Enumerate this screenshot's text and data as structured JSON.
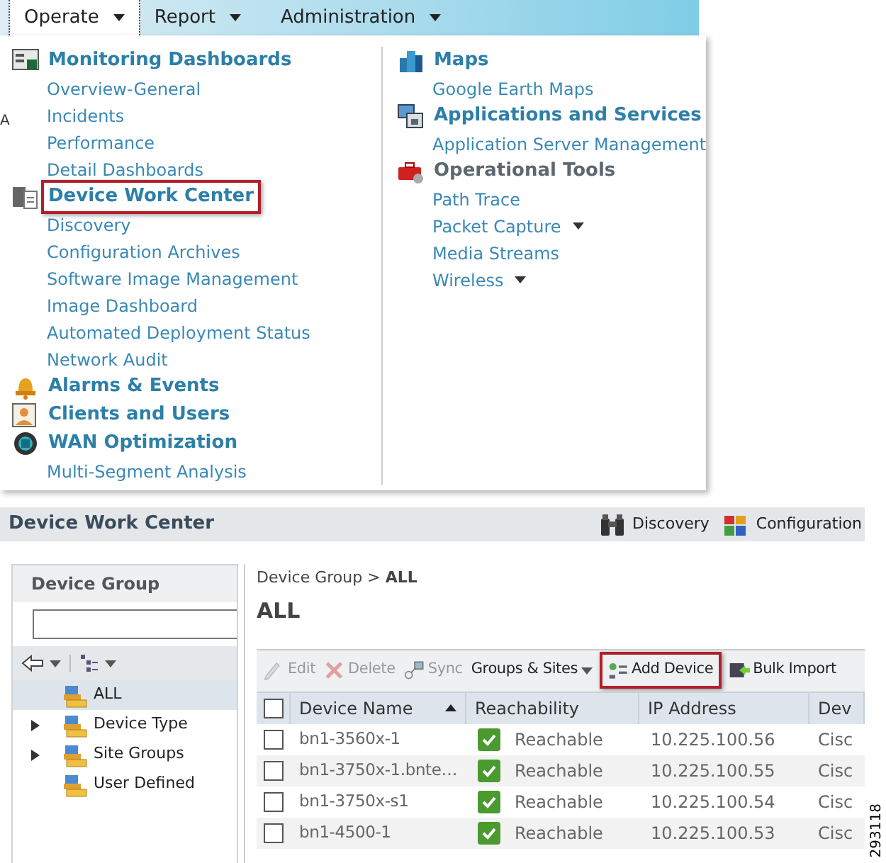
{
  "background_fragment": "A",
  "nav": {
    "tabs": [
      {
        "label": "Operate",
        "selected": true
      },
      {
        "label": "Report",
        "selected": false
      },
      {
        "label": "Administration",
        "selected": false
      }
    ]
  },
  "menu": {
    "columns": [
      {
        "sections": [
          {
            "heading": "Monitoring Dashboards",
            "muted": false,
            "highlighted": false,
            "items": [
              {
                "label": "Overview-General",
                "has_submenu": false
              },
              {
                "label": "Incidents",
                "has_submenu": false
              },
              {
                "label": "Performance",
                "has_submenu": false
              },
              {
                "label": "Detail Dashboards",
                "has_submenu": false
              }
            ]
          },
          {
            "heading": "Device Work Center",
            "muted": false,
            "highlighted": true,
            "items": [
              {
                "label": "Discovery",
                "has_submenu": false
              },
              {
                "label": "Configuration Archives",
                "has_submenu": false
              },
              {
                "label": "Software Image Management",
                "has_submenu": false
              },
              {
                "label": "Image Dashboard",
                "has_submenu": false
              },
              {
                "label": "Automated Deployment Status",
                "has_submenu": false
              },
              {
                "label": "Network Audit",
                "has_submenu": false
              }
            ]
          },
          {
            "heading": "Alarms & Events",
            "muted": false,
            "highlighted": false
          },
          {
            "heading": "Clients and Users",
            "muted": false,
            "highlighted": false
          },
          {
            "heading": "WAN Optimization",
            "muted": false,
            "highlighted": false,
            "items": [
              {
                "label": "Multi-Segment Analysis",
                "has_submenu": false
              }
            ]
          }
        ]
      },
      {
        "sections": [
          {
            "heading": "Maps",
            "muted": false,
            "highlighted": false,
            "items": [
              {
                "label": "Google Earth Maps",
                "has_submenu": false
              }
            ]
          },
          {
            "heading": "Applications and Services",
            "muted": false,
            "highlighted": false,
            "items": [
              {
                "label": "Application Server Management",
                "has_submenu": false
              }
            ]
          },
          {
            "heading": "Operational Tools",
            "muted": true,
            "highlighted": false,
            "items": [
              {
                "label": "Path Trace",
                "has_submenu": false
              },
              {
                "label": "Packet Capture",
                "has_submenu": true
              },
              {
                "label": "Media Streams",
                "has_submenu": false
              },
              {
                "label": "Wireless",
                "has_submenu": true
              }
            ]
          }
        ]
      }
    ]
  },
  "work_center": {
    "title": "Device Work Center",
    "links": [
      "Discovery",
      "Configuration"
    ],
    "device_group": {
      "title": "Device Group",
      "tree": [
        {
          "label": "ALL",
          "selected": true,
          "expandable": false
        },
        {
          "label": "Device Type",
          "selected": false,
          "expandable": true
        },
        {
          "label": "Site Groups",
          "selected": false,
          "expandable": true
        },
        {
          "label": "User Defined",
          "selected": false,
          "expandable": false
        }
      ]
    },
    "breadcrumb": "Device Group > **ALL**",
    "heading": "ALL",
    "toolbar": [
      {
        "kind": "edit",
        "label": "Edit",
        "disabled": true,
        "highlighted": false
      },
      {
        "kind": "delete",
        "label": "Delete",
        "disabled": true,
        "highlighted": false
      },
      {
        "kind": "sync",
        "label": "Sync",
        "disabled": true,
        "highlighted": false
      },
      {
        "kind": "menu",
        "label": "Groups & Sites",
        "disabled": false,
        "highlighted": false
      },
      {
        "kind": "add",
        "label": "Add Device",
        "disabled": false,
        "highlighted": true
      },
      {
        "kind": "import",
        "label": "Bulk Import",
        "disabled": false,
        "highlighted": false
      }
    ],
    "table": {
      "select_all_checked": false,
      "columns": [
        {
          "label": "Device Name",
          "sorted": true
        },
        {
          "label": "Reachability",
          "sorted": false
        },
        {
          "label": "IP Address",
          "sorted": false
        },
        {
          "label": "Dev",
          "sorted": false
        }
      ],
      "rows": [
        {
          "checked": false,
          "name": "bn1-3560x-1",
          "reachable": true,
          "reachability": "Reachable",
          "ip": "10.225.100.56",
          "column_4": "Cisc"
        },
        {
          "checked": false,
          "name": "bn1-3750x-1.bnte…",
          "reachable": true,
          "reachability": "Reachable",
          "ip": "10.225.100.55",
          "column_4": "Cisc"
        },
        {
          "checked": false,
          "name": "bn1-3750x-s1",
          "reachable": true,
          "reachability": "Reachable",
          "ip": "10.225.100.54",
          "column_4": "Cisc"
        },
        {
          "checked": false,
          "name": "bn1-4500-1",
          "reachable": true,
          "reachability": "Reachable",
          "ip": "10.225.100.53",
          "column_4": "Cisc"
        }
      ]
    }
  },
  "figure_number": "293118"
}
